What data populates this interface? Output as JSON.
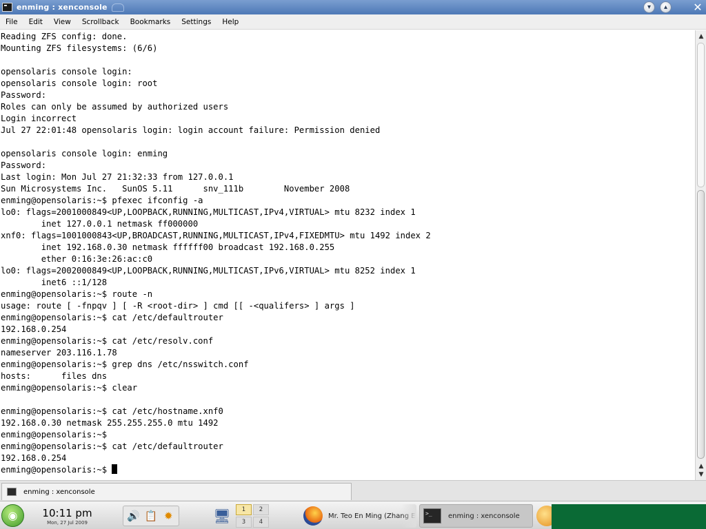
{
  "window": {
    "title": "enming : xenconsole",
    "minimize_glyph": "▾",
    "maximize_glyph": "▴",
    "close_glyph": "✕"
  },
  "menubar": {
    "items": [
      "File",
      "Edit",
      "View",
      "Scrollback",
      "Bookmarks",
      "Settings",
      "Help"
    ]
  },
  "terminal": {
    "lines": [
      "Reading ZFS config: done.",
      "Mounting ZFS filesystems: (6/6)",
      "",
      "opensolaris console login:",
      "opensolaris console login: root",
      "Password:",
      "Roles can only be assumed by authorized users",
      "Login incorrect",
      "Jul 27 22:01:48 opensolaris login: login account failure: Permission denied",
      "",
      "opensolaris console login: enming",
      "Password:",
      "Last login: Mon Jul 27 21:32:33 from 127.0.0.1",
      "Sun Microsystems Inc.   SunOS 5.11      snv_111b        November 2008",
      "enming@opensolaris:~$ pfexec ifconfig -a",
      "lo0: flags=2001000849<UP,LOOPBACK,RUNNING,MULTICAST,IPv4,VIRTUAL> mtu 8232 index 1",
      "        inet 127.0.0.1 netmask ff000000",
      "xnf0: flags=1001000843<UP,BROADCAST,RUNNING,MULTICAST,IPv4,FIXEDMTU> mtu 1492 index 2",
      "        inet 192.168.0.30 netmask ffffff00 broadcast 192.168.0.255",
      "        ether 0:16:3e:26:ac:c0",
      "lo0: flags=2002000849<UP,LOOPBACK,RUNNING,MULTICAST,IPv6,VIRTUAL> mtu 8252 index 1",
      "        inet6 ::1/128",
      "enming@opensolaris:~$ route -n",
      "usage: route [ -fnpqv ] [ -R <root-dir> ] cmd [[ -<qualifers> ] args ]",
      "enming@opensolaris:~$ cat /etc/defaultrouter",
      "192.168.0.254",
      "enming@opensolaris:~$ cat /etc/resolv.conf",
      "nameserver 203.116.1.78",
      "enming@opensolaris:~$ grep dns /etc/nsswitch.conf",
      "hosts:      files dns",
      "enming@opensolaris:~$ clear",
      "",
      "enming@opensolaris:~$ cat /etc/hostname.xnf0",
      "192.168.0.30 netmask 255.255.255.0 mtu 1492",
      "enming@opensolaris:~$",
      "enming@opensolaris:~$ cat /etc/defaultrouter",
      "192.168.0.254"
    ],
    "prompt": "enming@opensolaris:~$ "
  },
  "scrollbar": {
    "up_glyph": "▲",
    "down_glyph": "▼"
  },
  "session_tab": {
    "label": "enming : xenconsole"
  },
  "taskbar": {
    "clock_time": "10:11 pm",
    "clock_date": "Mon, 27 Jul 2009",
    "pager": [
      "1",
      "2",
      "3",
      "4"
    ],
    "tasks": {
      "firefox_label": "Mr. Teo En Ming (Zhang E",
      "console_label": "enming : xenconsole"
    },
    "icons": {
      "kmenu": "opensuse-gecko-icon",
      "speaker": "speaker-icon",
      "clipboard": "clipboard-icon",
      "updater": "updater-icon",
      "desktop": "show-desktop-icon"
    }
  }
}
